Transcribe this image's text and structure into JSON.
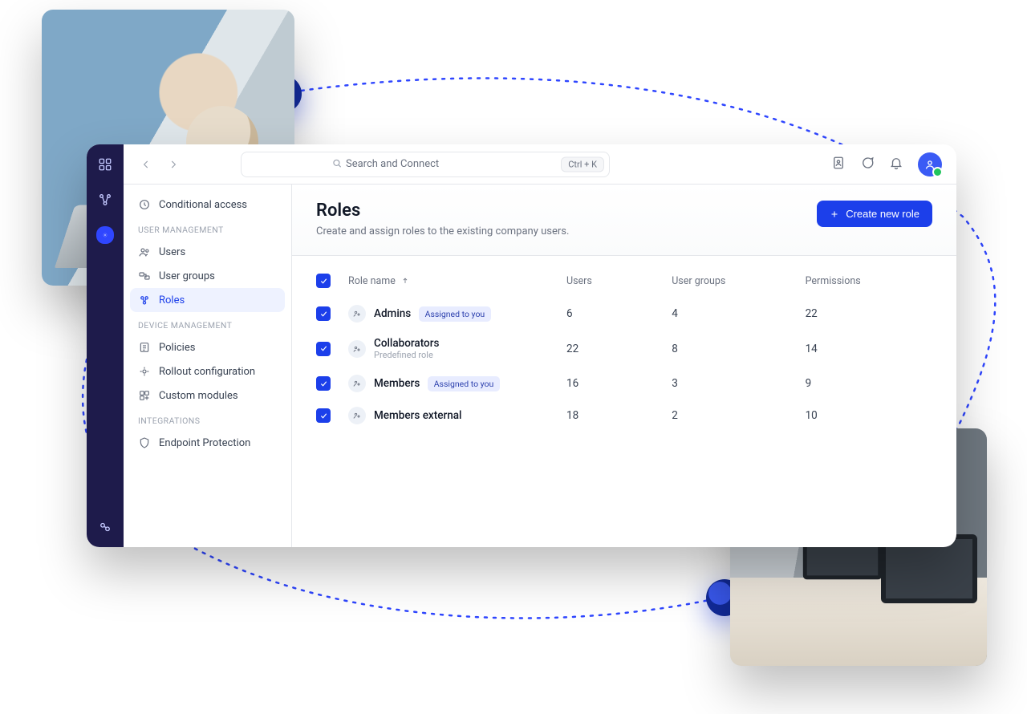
{
  "topbar": {
    "search_placeholder": "Search and Connect",
    "shortcut": "Ctrl + K"
  },
  "sidebar": {
    "above": {
      "label": "Conditional access"
    },
    "groups": [
      {
        "heading": "USER MANAGEMENT",
        "items": [
          {
            "label": "Users"
          },
          {
            "label": "User groups"
          },
          {
            "label": "Roles",
            "active": true
          }
        ]
      },
      {
        "heading": "DEVICE MANAGEMENT",
        "items": [
          {
            "label": "Policies"
          },
          {
            "label": "Rollout configuration"
          },
          {
            "label": "Custom modules"
          }
        ]
      },
      {
        "heading": "INTEGRATIONS",
        "items": [
          {
            "label": "Endpoint Protection"
          }
        ]
      }
    ]
  },
  "page": {
    "title": "Roles",
    "subtitle": "Create and assign roles to the existing company users.",
    "cta": "Create new role"
  },
  "table": {
    "col_role": "Role name",
    "col_users": "Users",
    "col_groups": "User groups",
    "col_perms": "Permissions",
    "rows": [
      {
        "name": "Admins",
        "subtitle": "",
        "badge": "Assigned to you",
        "users": "6",
        "groups": "4",
        "perms": "22"
      },
      {
        "name": "Collaborators",
        "subtitle": "Predefined role",
        "badge": "",
        "users": "22",
        "groups": "8",
        "perms": "14"
      },
      {
        "name": "Members",
        "subtitle": "",
        "badge": "Assigned to you",
        "users": "16",
        "groups": "3",
        "perms": "9"
      },
      {
        "name": "Members external",
        "subtitle": "",
        "badge": "",
        "users": "18",
        "groups": "2",
        "perms": "10"
      }
    ]
  }
}
